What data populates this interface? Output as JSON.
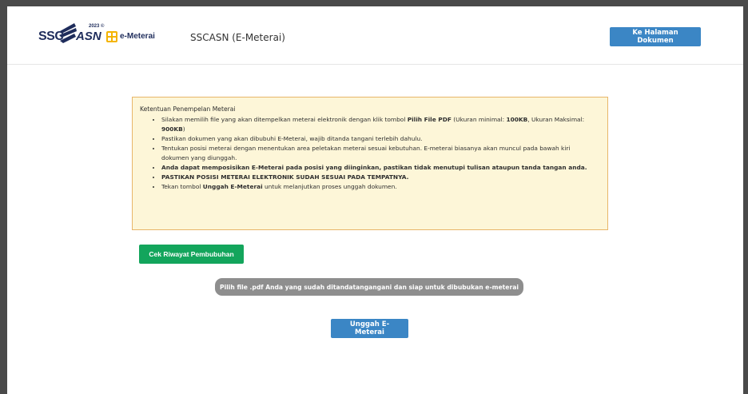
{
  "header": {
    "logo_ssc": "SSC",
    "logo_asn": "ASN",
    "logo_tag": "2023 ©",
    "emeterai_label": "e-Meterai",
    "app_title": "SSCASN (E-Meterai)",
    "dokumen_button": "Ke Halaman Dokumen"
  },
  "notice": {
    "title": "Ketentuan Penempelan Meterai",
    "item1_a": "Silakan memilih file yang akan ditempelkan meterai elektronik dengan klik tombol ",
    "item1_b": "Pilih File PDF",
    "item1_c": " (Ukuran minimal: ",
    "item1_d": "100KB",
    "item1_e": ", Ukuran Maksimal: ",
    "item1_f": "900KB",
    "item1_g": ")",
    "item2": "Pastikan dokumen yang akan dibubuhi E-Meterai, wajib ditanda tangani terlebih dahulu.",
    "item3": "Tentukan posisi meterai dengan menentukan area peletakan meterai sesuai kebutuhan. E-meterai biasanya akan muncul pada bawah kiri dokumen yang diunggah.",
    "item4": "Anda dapat memposisikan E-Meterai pada posisi yang diinginkan, pastikan tidak menutupi tulisan ataupun tanda tangan anda.",
    "item5": "PASTIKAN POSISI METERAI ELEKTRONIK SUDAH SESUAI PADA TEMPATNYA.",
    "item6_a": "Tekan tombol ",
    "item6_b": "Unggah E-Meterai",
    "item6_c": " untuk melanjutkan proses unggah dokumen."
  },
  "actions": {
    "riwayat_button": "Cek Riwayat Pembubuhan",
    "file_picker": "Pilih file .pdf Anda yang sudah ditandatangangani dan siap untuk dibubukan e-meterai",
    "unggah_button": "Unggah E-Meterai"
  },
  "colors": {
    "primary_blue": "#3b86c5",
    "green": "#13a55c",
    "notice_bg": "#fdf6d8",
    "notice_border": "#e8b66a",
    "pill_gray": "#8e8e8e"
  }
}
